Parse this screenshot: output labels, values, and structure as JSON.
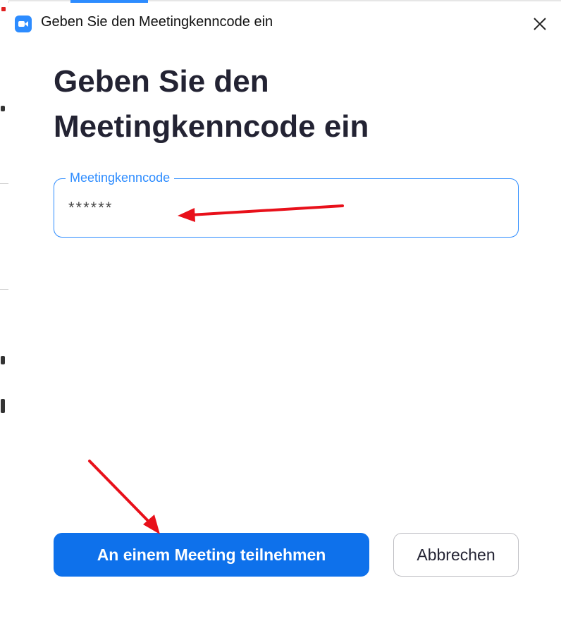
{
  "window": {
    "title": "Geben Sie den Meetingkenncode ein",
    "app_icon": "zoom-camera-icon",
    "close_icon": "close-icon"
  },
  "dialog": {
    "heading": "Geben Sie den Meetingkenncode ein",
    "passcode_field": {
      "label": "Meetingkenncode",
      "value": "******"
    },
    "join_button_label": "An einem Meeting teilnehmen",
    "cancel_button_label": "Abbrechen"
  },
  "colors": {
    "accent": "#2d8cff",
    "primary_button": "#0e71eb",
    "heading_text": "#232333",
    "annotation_arrow": "#e8101a"
  }
}
